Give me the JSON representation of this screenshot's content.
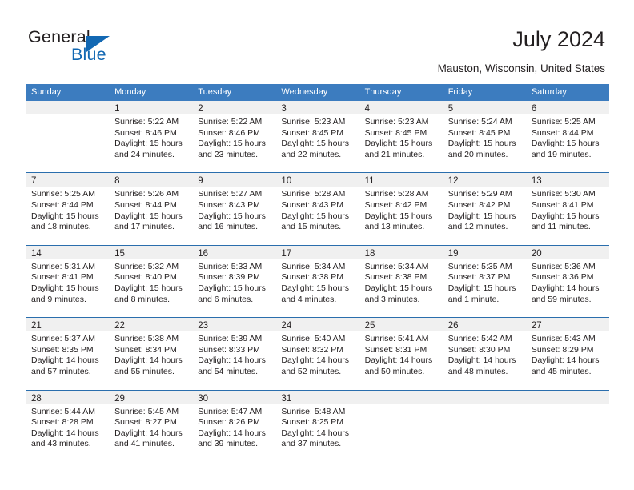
{
  "branding": {
    "name_primary": "General",
    "name_secondary": "Blue",
    "accent_color": "#1268b3"
  },
  "header": {
    "title": "July 2024",
    "subtitle": "Mauston, Wisconsin, United States"
  },
  "theme": {
    "header_row_bg": "#3c7cbf",
    "week_divider": "#2a6ead",
    "day_band_bg": "#f0f0f0",
    "text_color": "#231f20"
  },
  "weekday_headers": [
    "Sunday",
    "Monday",
    "Tuesday",
    "Wednesday",
    "Thursday",
    "Friday",
    "Saturday"
  ],
  "weeks": [
    [
      {
        "day": "",
        "sunrise": "",
        "sunset": "",
        "daylight_1": "",
        "daylight_2": "",
        "empty": true
      },
      {
        "day": "1",
        "sunrise": "Sunrise: 5:22 AM",
        "sunset": "Sunset: 8:46 PM",
        "daylight_1": "Daylight: 15 hours",
        "daylight_2": "and 24 minutes."
      },
      {
        "day": "2",
        "sunrise": "Sunrise: 5:22 AM",
        "sunset": "Sunset: 8:46 PM",
        "daylight_1": "Daylight: 15 hours",
        "daylight_2": "and 23 minutes."
      },
      {
        "day": "3",
        "sunrise": "Sunrise: 5:23 AM",
        "sunset": "Sunset: 8:45 PM",
        "daylight_1": "Daylight: 15 hours",
        "daylight_2": "and 22 minutes."
      },
      {
        "day": "4",
        "sunrise": "Sunrise: 5:23 AM",
        "sunset": "Sunset: 8:45 PM",
        "daylight_1": "Daylight: 15 hours",
        "daylight_2": "and 21 minutes."
      },
      {
        "day": "5",
        "sunrise": "Sunrise: 5:24 AM",
        "sunset": "Sunset: 8:45 PM",
        "daylight_1": "Daylight: 15 hours",
        "daylight_2": "and 20 minutes."
      },
      {
        "day": "6",
        "sunrise": "Sunrise: 5:25 AM",
        "sunset": "Sunset: 8:44 PM",
        "daylight_1": "Daylight: 15 hours",
        "daylight_2": "and 19 minutes."
      }
    ],
    [
      {
        "day": "7",
        "sunrise": "Sunrise: 5:25 AM",
        "sunset": "Sunset: 8:44 PM",
        "daylight_1": "Daylight: 15 hours",
        "daylight_2": "and 18 minutes."
      },
      {
        "day": "8",
        "sunrise": "Sunrise: 5:26 AM",
        "sunset": "Sunset: 8:44 PM",
        "daylight_1": "Daylight: 15 hours",
        "daylight_2": "and 17 minutes."
      },
      {
        "day": "9",
        "sunrise": "Sunrise: 5:27 AM",
        "sunset": "Sunset: 8:43 PM",
        "daylight_1": "Daylight: 15 hours",
        "daylight_2": "and 16 minutes."
      },
      {
        "day": "10",
        "sunrise": "Sunrise: 5:28 AM",
        "sunset": "Sunset: 8:43 PM",
        "daylight_1": "Daylight: 15 hours",
        "daylight_2": "and 15 minutes."
      },
      {
        "day": "11",
        "sunrise": "Sunrise: 5:28 AM",
        "sunset": "Sunset: 8:42 PM",
        "daylight_1": "Daylight: 15 hours",
        "daylight_2": "and 13 minutes."
      },
      {
        "day": "12",
        "sunrise": "Sunrise: 5:29 AM",
        "sunset": "Sunset: 8:42 PM",
        "daylight_1": "Daylight: 15 hours",
        "daylight_2": "and 12 minutes."
      },
      {
        "day": "13",
        "sunrise": "Sunrise: 5:30 AM",
        "sunset": "Sunset: 8:41 PM",
        "daylight_1": "Daylight: 15 hours",
        "daylight_2": "and 11 minutes."
      }
    ],
    [
      {
        "day": "14",
        "sunrise": "Sunrise: 5:31 AM",
        "sunset": "Sunset: 8:41 PM",
        "daylight_1": "Daylight: 15 hours",
        "daylight_2": "and 9 minutes."
      },
      {
        "day": "15",
        "sunrise": "Sunrise: 5:32 AM",
        "sunset": "Sunset: 8:40 PM",
        "daylight_1": "Daylight: 15 hours",
        "daylight_2": "and 8 minutes."
      },
      {
        "day": "16",
        "sunrise": "Sunrise: 5:33 AM",
        "sunset": "Sunset: 8:39 PM",
        "daylight_1": "Daylight: 15 hours",
        "daylight_2": "and 6 minutes."
      },
      {
        "day": "17",
        "sunrise": "Sunrise: 5:34 AM",
        "sunset": "Sunset: 8:38 PM",
        "daylight_1": "Daylight: 15 hours",
        "daylight_2": "and 4 minutes."
      },
      {
        "day": "18",
        "sunrise": "Sunrise: 5:34 AM",
        "sunset": "Sunset: 8:38 PM",
        "daylight_1": "Daylight: 15 hours",
        "daylight_2": "and 3 minutes."
      },
      {
        "day": "19",
        "sunrise": "Sunrise: 5:35 AM",
        "sunset": "Sunset: 8:37 PM",
        "daylight_1": "Daylight: 15 hours",
        "daylight_2": "and 1 minute."
      },
      {
        "day": "20",
        "sunrise": "Sunrise: 5:36 AM",
        "sunset": "Sunset: 8:36 PM",
        "daylight_1": "Daylight: 14 hours",
        "daylight_2": "and 59 minutes."
      }
    ],
    [
      {
        "day": "21",
        "sunrise": "Sunrise: 5:37 AM",
        "sunset": "Sunset: 8:35 PM",
        "daylight_1": "Daylight: 14 hours",
        "daylight_2": "and 57 minutes."
      },
      {
        "day": "22",
        "sunrise": "Sunrise: 5:38 AM",
        "sunset": "Sunset: 8:34 PM",
        "daylight_1": "Daylight: 14 hours",
        "daylight_2": "and 55 minutes."
      },
      {
        "day": "23",
        "sunrise": "Sunrise: 5:39 AM",
        "sunset": "Sunset: 8:33 PM",
        "daylight_1": "Daylight: 14 hours",
        "daylight_2": "and 54 minutes."
      },
      {
        "day": "24",
        "sunrise": "Sunrise: 5:40 AM",
        "sunset": "Sunset: 8:32 PM",
        "daylight_1": "Daylight: 14 hours",
        "daylight_2": "and 52 minutes."
      },
      {
        "day": "25",
        "sunrise": "Sunrise: 5:41 AM",
        "sunset": "Sunset: 8:31 PM",
        "daylight_1": "Daylight: 14 hours",
        "daylight_2": "and 50 minutes."
      },
      {
        "day": "26",
        "sunrise": "Sunrise: 5:42 AM",
        "sunset": "Sunset: 8:30 PM",
        "daylight_1": "Daylight: 14 hours",
        "daylight_2": "and 48 minutes."
      },
      {
        "day": "27",
        "sunrise": "Sunrise: 5:43 AM",
        "sunset": "Sunset: 8:29 PM",
        "daylight_1": "Daylight: 14 hours",
        "daylight_2": "and 45 minutes."
      }
    ],
    [
      {
        "day": "28",
        "sunrise": "Sunrise: 5:44 AM",
        "sunset": "Sunset: 8:28 PM",
        "daylight_1": "Daylight: 14 hours",
        "daylight_2": "and 43 minutes."
      },
      {
        "day": "29",
        "sunrise": "Sunrise: 5:45 AM",
        "sunset": "Sunset: 8:27 PM",
        "daylight_1": "Daylight: 14 hours",
        "daylight_2": "and 41 minutes."
      },
      {
        "day": "30",
        "sunrise": "Sunrise: 5:47 AM",
        "sunset": "Sunset: 8:26 PM",
        "daylight_1": "Daylight: 14 hours",
        "daylight_2": "and 39 minutes."
      },
      {
        "day": "31",
        "sunrise": "Sunrise: 5:48 AM",
        "sunset": "Sunset: 8:25 PM",
        "daylight_1": "Daylight: 14 hours",
        "daylight_2": "and 37 minutes."
      },
      {
        "day": "",
        "sunrise": "",
        "sunset": "",
        "daylight_1": "",
        "daylight_2": "",
        "empty": true
      },
      {
        "day": "",
        "sunrise": "",
        "sunset": "",
        "daylight_1": "",
        "daylight_2": "",
        "empty": true
      },
      {
        "day": "",
        "sunrise": "",
        "sunset": "",
        "daylight_1": "",
        "daylight_2": "",
        "empty": true
      }
    ]
  ]
}
